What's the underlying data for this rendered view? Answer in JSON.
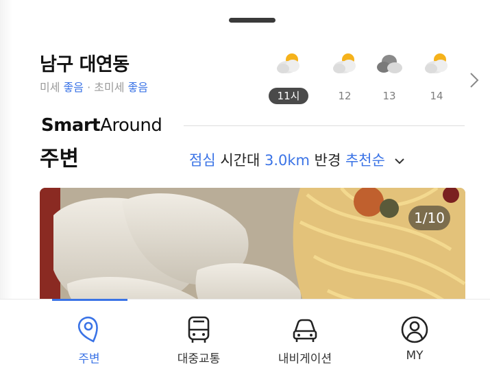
{
  "header": {
    "location": "남구 대연동",
    "air_quality": {
      "fine_dust_label": "미세",
      "fine_dust_value": "좋음",
      "separator": " · ",
      "ultrafine_dust_label": "초미세",
      "ultrafine_dust_value": "좋음"
    }
  },
  "weather": {
    "hours": [
      {
        "label": "11시",
        "icon": "partly-cloudy-icon",
        "active": true
      },
      {
        "label": "12",
        "icon": "partly-cloudy-icon",
        "active": false
      },
      {
        "label": "13",
        "icon": "cloudy-icon",
        "active": false
      },
      {
        "label": "14",
        "icon": "partly-cloudy-icon",
        "active": false
      }
    ]
  },
  "section": {
    "brand_bold": "Smart",
    "brand_light": "Around",
    "title": "주변",
    "filter": {
      "time": "점심",
      "time_suffix": " 시간대 ",
      "radius": "3.0km",
      "radius_suffix": " 반경 ",
      "sort": "추천순"
    },
    "photo_counter": "1/10"
  },
  "bottom_nav": {
    "items": [
      {
        "label": "주변",
        "icon": "location-pin-icon",
        "active": true
      },
      {
        "label": "대중교통",
        "icon": "bus-icon",
        "active": false
      },
      {
        "label": "내비게이션",
        "icon": "car-icon",
        "active": false
      },
      {
        "label": "MY",
        "icon": "user-profile-icon",
        "active": false
      }
    ]
  },
  "colors": {
    "accent": "#3a73e6",
    "active_hour_bg": "#4a4a4a"
  }
}
